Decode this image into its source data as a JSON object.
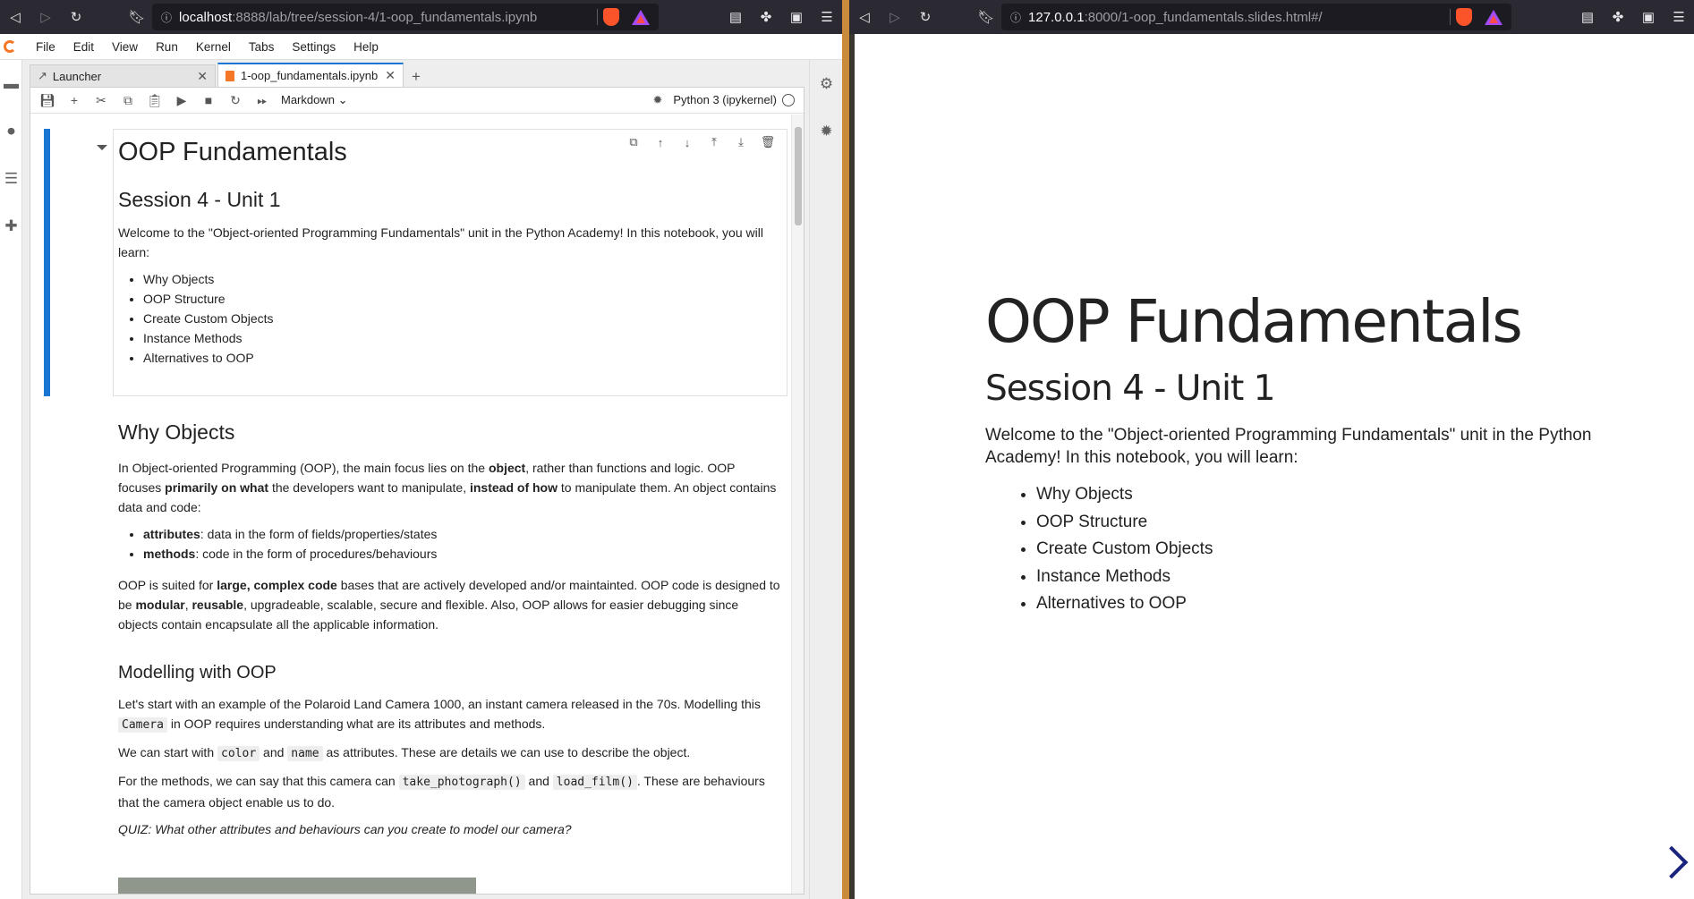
{
  "left_browser": {
    "url_host": "localhost",
    "url_rest": ":8888/lab/tree/session-4/1-oop_fundamentals.ipynb"
  },
  "right_browser": {
    "url_host": "127.0.0.1",
    "url_rest": ":8000/1-oop_fundamentals.slides.html#/"
  },
  "jupyter": {
    "menu": [
      "File",
      "Edit",
      "View",
      "Run",
      "Kernel",
      "Tabs",
      "Settings",
      "Help"
    ],
    "tabs": [
      {
        "label": "Launcher"
      },
      {
        "label": "1-oop_fundamentals.ipynb"
      }
    ],
    "toolbar": {
      "cell_type": "Markdown",
      "kernel": "Python 3 (ipykernel)"
    }
  },
  "notebook": {
    "title": "OOP Fundamentals",
    "subtitle": "Session 4 - Unit 1",
    "intro": "Welcome to the \"Object-oriented Programming Fundamentals\" unit in the Python Academy! In this notebook, you will learn:",
    "topics": [
      "Why Objects",
      "OOP Structure",
      "Create Custom Objects",
      "Instance Methods",
      "Alternatives to OOP"
    ],
    "why_heading": "Why Objects",
    "why_p1_a": "In Object-oriented Programming (OOP), the main focus lies on the ",
    "why_p1_b": "object",
    "why_p1_c": ", rather than functions and logic. OOP focuses ",
    "why_p1_d": "primarily on what",
    "why_p1_e": " the developers want to manipulate, ",
    "why_p1_f": "instead of how",
    "why_p1_g": " to manipulate them. An object contains data and code:",
    "why_list": [
      {
        "term": "attributes",
        "desc": ": data in the form of fields/properties/states"
      },
      {
        "term": "methods",
        "desc": ": code in the form of procedures/behaviours"
      }
    ],
    "why_p2_a": "OOP is suited for ",
    "why_p2_b": "large, complex code",
    "why_p2_c": " bases that are actively developed and/or maintainted. OOP code is designed to be ",
    "why_p2_d": "modular",
    "why_p2_e": ", ",
    "why_p2_f": "reusable",
    "why_p2_g": ", upgradeable, scalable, secure and flexible. Also, OOP allows for easier debugging since objects contain encapsulate all the applicable information.",
    "model_heading": "Modelling with OOP",
    "model_p1_a": "Let's start with an example of the Polaroid Land Camera 1000, an instant camera released in the 70s. Modelling this ",
    "model_p1_code": "Camera",
    "model_p1_b": " in OOP requires understanding what are its attributes and methods.",
    "model_p2_a": "We can start with ",
    "model_p2_code1": "color",
    "model_p2_b": " and ",
    "model_p2_code2": "name",
    "model_p2_c": " as attributes. These are details we can use to describe the object.",
    "model_p3_a": "For the methods, we can say that this camera can ",
    "model_p3_code1": "take_photograph()",
    "model_p3_b": " and ",
    "model_p3_code2": "load_film()",
    "model_p3_c": ". These are behaviours that the camera object enable us to do.",
    "quiz": "QUIZ: What other attributes and behaviours can you create to model our camera?"
  },
  "slide": {
    "title": "OOP Fundamentals",
    "subtitle": "Session 4 - Unit 1",
    "intro": "Welcome to the \"Object-oriented Programming Fundamentals\" unit in the Python Academy! In this notebook, you will learn:",
    "topics": [
      "Why Objects",
      "OOP Structure",
      "Create Custom Objects",
      "Instance Methods",
      "Alternatives to OOP"
    ]
  },
  "colors": {
    "accent": "#1976d2",
    "browser_bar": "#2b2a33",
    "slide_nav": "#1a237e"
  }
}
